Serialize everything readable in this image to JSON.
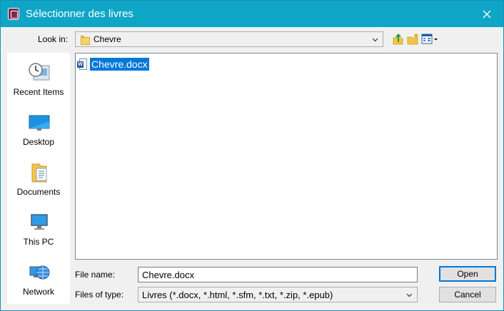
{
  "window": {
    "title": "Sélectionner des livres"
  },
  "toolbar": {
    "look_in_label": "Look in:",
    "look_in_value": "Chevre",
    "up_icon": "up-folder-icon",
    "new_folder_icon": "new-folder-icon",
    "view_menu_icon": "view-menu-icon"
  },
  "places": [
    {
      "label": "Recent Items",
      "icon": "recent-items-icon"
    },
    {
      "label": "Desktop",
      "icon": "desktop-icon"
    },
    {
      "label": "Documents",
      "icon": "documents-icon"
    },
    {
      "label": "This PC",
      "icon": "this-pc-icon"
    },
    {
      "label": "Network",
      "icon": "network-icon"
    }
  ],
  "files": [
    {
      "name": "Chevre.docx",
      "icon": "word-doc-icon",
      "selected": true
    }
  ],
  "form": {
    "file_name_label": "File name:",
    "file_name_value": "Chevre.docx",
    "file_type_label": "Files of type:",
    "file_type_value": "Livres (*.docx, *.html, *.sfm, *.txt, *.zip, *.epub)"
  },
  "buttons": {
    "open": "Open",
    "cancel": "Cancel"
  },
  "colors": {
    "titlebar": "#0ea5c6",
    "selection": "#0078d7",
    "accent": "#0078d7"
  }
}
